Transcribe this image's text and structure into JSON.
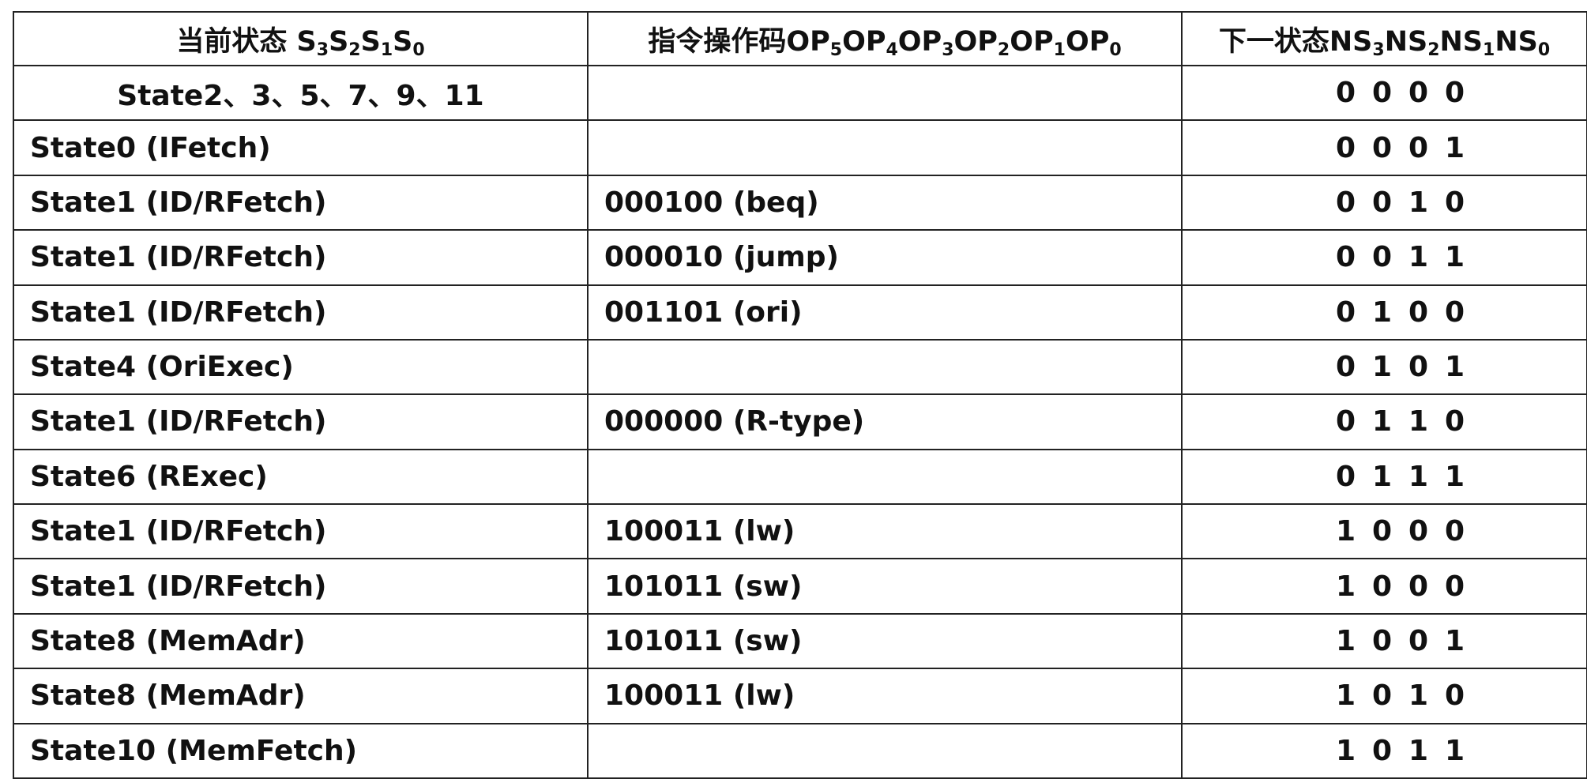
{
  "table": {
    "headers": {
      "current": {
        "text": "当前状态 ",
        "subs": [
          [
            "S",
            "3"
          ],
          [
            "S",
            "2"
          ],
          [
            "S",
            "1"
          ],
          [
            "S",
            "0"
          ]
        ]
      },
      "opcode": {
        "text": "指令操作码",
        "subs": [
          [
            "OP",
            "5"
          ],
          [
            "OP",
            "4"
          ],
          [
            "OP",
            "3"
          ],
          [
            "OP",
            "2"
          ],
          [
            "OP",
            "1"
          ],
          [
            "OP",
            "0"
          ]
        ]
      },
      "next": {
        "text": "下一状态",
        "subs": [
          [
            "NS",
            "3"
          ],
          [
            "NS",
            "2"
          ],
          [
            "NS",
            "1"
          ],
          [
            "NS",
            "0"
          ]
        ]
      }
    },
    "rows": [
      {
        "state": "State2、3、5、7、9、11",
        "opcode": "",
        "next": [
          "0",
          "0",
          "0",
          "0"
        ]
      },
      {
        "state": "State0 (IFetch)",
        "opcode": "",
        "next": [
          "0",
          "0",
          "0",
          "1"
        ]
      },
      {
        "state": "State1 (ID/RFetch)",
        "opcode": "000100 (beq)",
        "next": [
          "0",
          "0",
          "1",
          "0"
        ]
      },
      {
        "state": "State1 (ID/RFetch)",
        "opcode": "000010 (jump)",
        "next": [
          "0",
          "0",
          "1",
          "1"
        ]
      },
      {
        "state": "State1 (ID/RFetch)",
        "opcode": "001101 (ori)",
        "next": [
          "0",
          "1",
          "0",
          "0"
        ]
      },
      {
        "state": "State4 (OriExec)",
        "opcode": "",
        "next": [
          "0",
          "1",
          "0",
          "1"
        ]
      },
      {
        "state": "State1 (ID/RFetch)",
        "opcode": "000000 (R-type)",
        "next": [
          "0",
          "1",
          "1",
          "0"
        ]
      },
      {
        "state": "State6 (RExec)",
        "opcode": "",
        "next": [
          "0",
          "1",
          "1",
          "1"
        ]
      },
      {
        "state": "State1 (ID/RFetch)",
        "opcode": "100011 (lw)",
        "next": [
          "1",
          "0",
          "0",
          "0"
        ]
      },
      {
        "state": "State1 (ID/RFetch)",
        "opcode": "101011 (sw)",
        "next": [
          "1",
          "0",
          "0",
          "0"
        ]
      },
      {
        "state": "State8 (MemAdr)",
        "opcode": "101011 (sw)",
        "next": [
          "1",
          "0",
          "0",
          "1"
        ]
      },
      {
        "state": "State8 (MemAdr)",
        "opcode": "100011 (lw)",
        "next": [
          "1",
          "0",
          "1",
          "0"
        ]
      },
      {
        "state": "State10 (MemFetch)",
        "opcode": "",
        "next": [
          "1",
          "0",
          "1",
          "1"
        ]
      }
    ]
  }
}
